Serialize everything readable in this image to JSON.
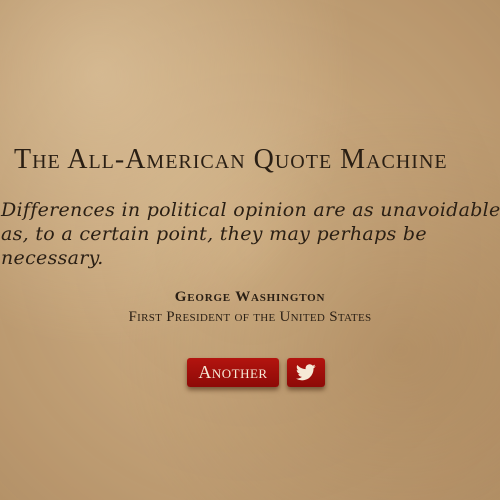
{
  "app": {
    "title": "The All-American Quote Machine"
  },
  "quote": {
    "text": "Differences in political opinion are as unavoidable as, to a certain point, they may perhaps be necessary.",
    "author": "George Washington",
    "author_role": "First President of the United States"
  },
  "actions": {
    "another_label": "Another",
    "tweet_icon": "twitter-bird-icon"
  },
  "colors": {
    "background": "#c5a57c",
    "text": "#2a1f14",
    "button": "#a0100c",
    "button_text": "#f6e9d6"
  }
}
